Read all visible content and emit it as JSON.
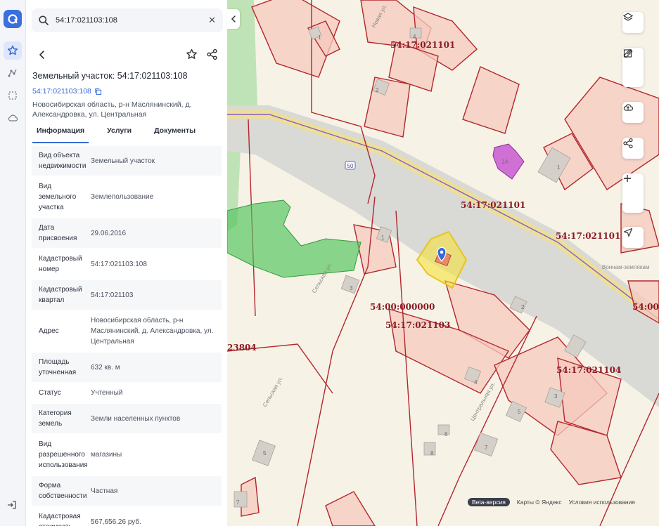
{
  "search": {
    "value": "54:17:021103:108"
  },
  "object": {
    "title": "Земельный участок: 54:17:021103:108",
    "cadastral_link": "54:17:021103:108",
    "address": "Новосибирская область, р-н Маслянинский, д. Александровка, ул. Центральная"
  },
  "tabs": [
    {
      "label": "Информация"
    },
    {
      "label": "Услуги"
    },
    {
      "label": "Документы"
    }
  ],
  "properties": [
    {
      "key": "Вид объекта недвижимости",
      "value": "Земельный участок"
    },
    {
      "key": "Вид земельного участка",
      "value": "Землепользование"
    },
    {
      "key": "Дата присвоения",
      "value": "29.06.2016"
    },
    {
      "key": "Кадастровый номер",
      "value": "54:17:021103:108"
    },
    {
      "key": "Кадастровый квартал",
      "value": "54:17:021103"
    },
    {
      "key": "Адрес",
      "value": "Новосибирская область, р-н Маслянинский, д. Александровка, ул. Центральная"
    },
    {
      "key": "Площадь уточненная",
      "value": "632 кв. м"
    },
    {
      "key": "Статус",
      "value": "Учтенный"
    },
    {
      "key": "Категория земель",
      "value": "Земли населенных пунктов"
    },
    {
      "key": "Вид разрешенного использования",
      "value": "магазины"
    },
    {
      "key": "Форма собственности",
      "value": "Частная"
    },
    {
      "key": "Кадастровая стоимость",
      "value": "567,656.26 руб."
    }
  ],
  "map": {
    "quarter_labels": [
      {
        "text": "54:17:021101"
      },
      {
        "text": "54:17:021101"
      },
      {
        "text": "54:17:021101"
      },
      {
        "text": "54:00:000000"
      },
      {
        "text": "54:17:021103"
      },
      {
        "text": "54:17:021104"
      },
      {
        "text": "54:00"
      },
      {
        "text": "23804"
      }
    ],
    "street_labels": [
      {
        "text": "Новая ул."
      },
      {
        "text": "Сельская ул."
      },
      {
        "text": "Сельская ул."
      },
      {
        "text": "Центральная ул."
      },
      {
        "text": "Воинам-землякам"
      }
    ],
    "road_badge": "50",
    "footer": {
      "beta": "Beta-версия",
      "copyright": "Карты © Яндекс",
      "terms": "Условия использования"
    }
  },
  "colors": {
    "accent": "#3569d6",
    "parcel_fill": "#f6c9be",
    "parcel_stroke": "#b3262e",
    "selected_fill": "#f5e12e",
    "green_area": "#4fc35b",
    "highlight_building": "#c85bd0"
  }
}
